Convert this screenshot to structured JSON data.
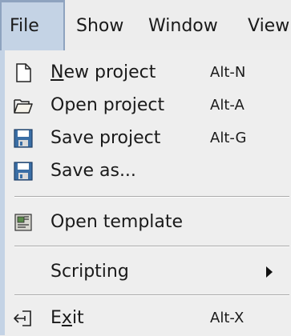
{
  "menubar": {
    "items": [
      {
        "label": "File",
        "active": true
      },
      {
        "label": "Show"
      },
      {
        "label": "Window"
      },
      {
        "label": "View"
      }
    ]
  },
  "file_menu": {
    "items": [
      {
        "mnemonic": "N",
        "label_rest": "ew project",
        "accelerator": "Alt-N",
        "icon": "new-document-icon"
      },
      {
        "label": "Open project",
        "accelerator": "Alt-A",
        "icon": "open-folder-icon"
      },
      {
        "label": "Save project",
        "accelerator": "Alt-G",
        "icon": "floppy-disk-icon"
      },
      {
        "label": "Save as...",
        "icon": "floppy-disk-icon"
      },
      {
        "label": "Open template",
        "icon": "template-icon"
      },
      {
        "label": "Scripting",
        "submenu": true
      },
      {
        "label_pre": "E",
        "mnemonic": "x",
        "label_rest": "it",
        "accelerator": "Alt-X",
        "icon": "exit-icon"
      }
    ]
  },
  "colors": {
    "menubar_active_bg": "#c4d3e5",
    "menu_bg": "#eeeeee",
    "floppy_blue": "#3a6ea5"
  }
}
